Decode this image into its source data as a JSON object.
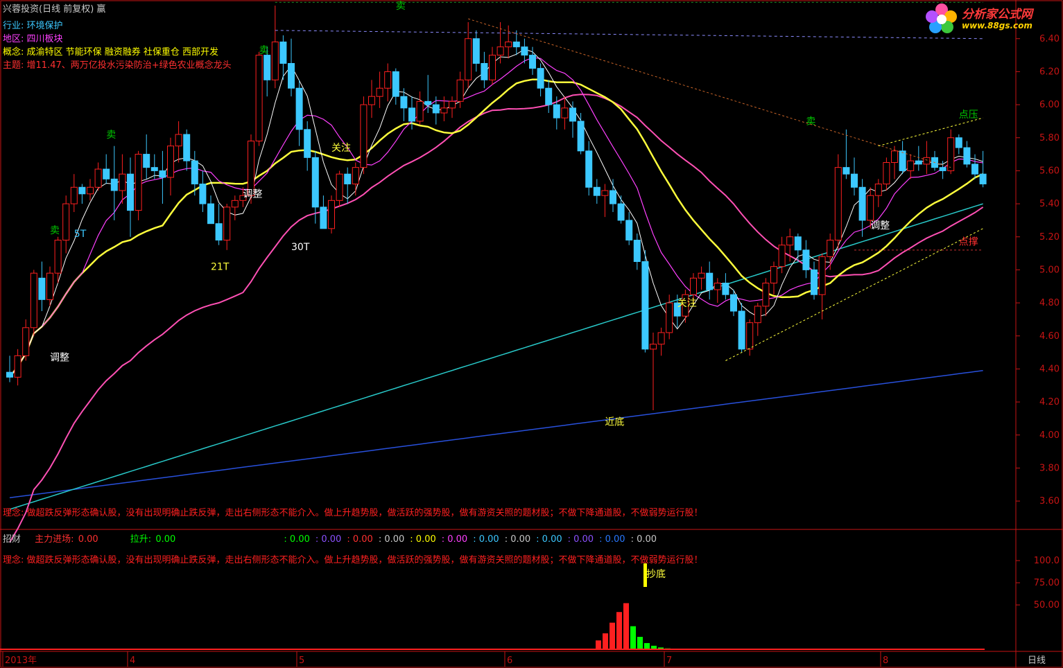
{
  "header": {
    "title": "兴蓉投资(日线 前复权) 赢",
    "industry_label": "行业:",
    "industry": "环境保护",
    "region_label": "地区:",
    "region": "四川板块",
    "concept_label": "概念:",
    "concept": "成渝特区 节能环保 融资融券 社保重仓 西部开发",
    "theme_label": "主题:",
    "theme": "增11.47、两万亿投水污染防治+绿色农业概念龙头"
  },
  "logo": {
    "name": "分析家公式网",
    "url_text": "www.88gs.com"
  },
  "colors": {
    "up": "#ff2020",
    "down": "#3cc8ff",
    "ma5": "#ffffff",
    "ma10": "#ff40ff",
    "ma20": "#ffff3c",
    "ma30_green": "#1e8c28",
    "ma60": "#ff50b4",
    "ma120": "#28c8c8",
    "ma250": "#2850dc",
    "axis": "#c81414"
  },
  "philosophy": "理念: 做超跌反弹形态确认股，没有出现明确止跌反弹，走出右侧形态不能介入。做上升趋势股，做活跃的强势股，做有游资关照的题材股；不做下降通道股，不做弱势运行股！",
  "sub_panel": {
    "name": "招财",
    "main_in_label": "主力进场:",
    "main_in_value": "0.00",
    "lift_label": "拉升:",
    "lift_value": "0.00",
    "values": [
      ": 0.00",
      ": 0.00",
      ": 0.00",
      ": 0.00",
      ": 0.00",
      ": 0.00",
      ": 0.00",
      ": 0.00",
      ": 0.00",
      ": 0.00",
      ": 0.00",
      ": 0.00"
    ],
    "value_colors": [
      "#00ff00",
      "#8c50ff",
      "#ff3030",
      "#c8c8c8",
      "#ffff00",
      "#ff40ff",
      "#3cc8ff",
      "#c8c8c8",
      "#3cc8ff",
      "#8c50ff",
      "#2878ff",
      "#c8c8c8"
    ],
    "marker": "抄底",
    "y_ticks": [
      "100.0",
      "75.00",
      "50.00"
    ],
    "histogram": [
      {
        "x": 863,
        "v": 10,
        "c": "#ff2020"
      },
      {
        "x": 873,
        "v": 18,
        "c": "#ff2020"
      },
      {
        "x": 883,
        "v": 30,
        "c": "#ff2020"
      },
      {
        "x": 893,
        "v": 42,
        "c": "#ff2020"
      },
      {
        "x": 903,
        "v": 52,
        "c": "#ff2020"
      },
      {
        "x": 913,
        "v": 26,
        "c": "#00ff00"
      },
      {
        "x": 923,
        "v": 14,
        "c": "#00ff00"
      },
      {
        "x": 933,
        "v": 7,
        "c": "#00ff00"
      },
      {
        "x": 943,
        "v": 4,
        "c": "#00ff00"
      },
      {
        "x": 953,
        "v": 2,
        "c": "#00ff00"
      },
      {
        "x": 963,
        "v": 1,
        "c": "#00ff00"
      }
    ]
  },
  "x_axis": {
    "labels": [
      "2013年",
      "4",
      "5",
      "6",
      "7",
      "8"
    ],
    "period_label": "日线"
  },
  "chart_data": {
    "type": "candlestick",
    "y_ticks": [
      "6.40",
      "6.20",
      "6.00",
      "5.80",
      "5.60",
      "5.40",
      "5.20",
      "5.00",
      "4.80",
      "4.60",
      "4.40",
      "4.20",
      "4.00",
      "3.80",
      "3.60"
    ],
    "ylim": [
      3.55,
      6.55
    ],
    "candles": [
      [
        4.38,
        4.48,
        4.32,
        4.35
      ],
      [
        4.35,
        4.52,
        4.3,
        4.48
      ],
      [
        4.48,
        4.7,
        4.45,
        4.65
      ],
      [
        4.65,
        5.0,
        4.6,
        4.98
      ],
      [
        4.95,
        5.05,
        4.75,
        4.82
      ],
      [
        4.82,
        5.02,
        4.78,
        4.98
      ],
      [
        4.98,
        5.2,
        4.92,
        5.18
      ],
      [
        5.18,
        5.45,
        5.1,
        5.4
      ],
      [
        5.4,
        5.58,
        5.35,
        5.5
      ],
      [
        5.5,
        5.52,
        5.4,
        5.46
      ],
      [
        5.46,
        5.55,
        5.42,
        5.5
      ],
      [
        5.5,
        5.65,
        5.48,
        5.61
      ],
      [
        5.61,
        5.7,
        5.52,
        5.55
      ],
      [
        5.55,
        5.75,
        5.3,
        5.48
      ],
      [
        5.48,
        5.7,
        5.4,
        5.58
      ],
      [
        5.58,
        5.68,
        5.2,
        5.36
      ],
      [
        5.36,
        5.72,
        5.3,
        5.7
      ],
      [
        5.7,
        5.82,
        5.55,
        5.62
      ],
      [
        5.62,
        5.7,
        5.55,
        5.6
      ],
      [
        5.6,
        5.72,
        5.4,
        5.56
      ],
      [
        5.56,
        5.8,
        5.45,
        5.75
      ],
      [
        5.75,
        5.9,
        5.65,
        5.82
      ],
      [
        5.82,
        5.85,
        5.6,
        5.66
      ],
      [
        5.66,
        5.72,
        5.45,
        5.52
      ],
      [
        5.52,
        5.6,
        5.35,
        5.4
      ],
      [
        5.4,
        5.45,
        5.28,
        5.28
      ],
      [
        5.28,
        5.4,
        5.15,
        5.18
      ],
      [
        5.18,
        5.4,
        5.12,
        5.38
      ],
      [
        5.38,
        5.45,
        5.3,
        5.42
      ],
      [
        5.42,
        5.5,
        5.38,
        5.45
      ],
      [
        5.45,
        5.82,
        5.4,
        5.78
      ],
      [
        5.78,
        6.32,
        5.75,
        6.3
      ],
      [
        6.3,
        6.35,
        6.05,
        6.15
      ],
      [
        6.15,
        6.6,
        6.1,
        6.38
      ],
      [
        6.38,
        6.42,
        6.15,
        6.25
      ],
      [
        6.25,
        6.4,
        6.05,
        6.1
      ],
      [
        6.1,
        6.15,
        5.75,
        5.85
      ],
      [
        5.85,
        5.9,
        5.6,
        5.68
      ],
      [
        5.68,
        5.72,
        5.28,
        5.38
      ],
      [
        5.38,
        5.45,
        5.25,
        5.25
      ],
      [
        5.25,
        5.45,
        5.22,
        5.42
      ],
      [
        5.42,
        5.6,
        5.38,
        5.58
      ],
      [
        5.58,
        5.62,
        5.4,
        5.52
      ],
      [
        5.52,
        5.65,
        5.45,
        5.62
      ],
      [
        5.62,
        6.05,
        5.58,
        6.0
      ],
      [
        6.0,
        6.15,
        5.92,
        6.05
      ],
      [
        6.05,
        6.2,
        5.98,
        6.1
      ],
      [
        6.1,
        6.25,
        6.02,
        6.2
      ],
      [
        6.2,
        6.22,
        6.0,
        6.05
      ],
      [
        6.05,
        6.1,
        5.9,
        5.98
      ],
      [
        5.98,
        6.05,
        5.85,
        5.9
      ],
      [
        5.9,
        6.08,
        5.88,
        6.02
      ],
      [
        6.02,
        6.18,
        5.95,
        6.0
      ],
      [
        6.0,
        6.05,
        5.88,
        5.95
      ],
      [
        5.95,
        6.05,
        5.9,
        5.98
      ],
      [
        5.98,
        6.05,
        5.92,
        6.02
      ],
      [
        6.02,
        6.2,
        5.98,
        6.15
      ],
      [
        6.15,
        6.5,
        6.1,
        6.4
      ],
      [
        6.4,
        6.45,
        6.2,
        6.25
      ],
      [
        6.25,
        6.32,
        6.1,
        6.15
      ],
      [
        6.15,
        6.35,
        6.12,
        6.3
      ],
      [
        6.3,
        6.5,
        6.25,
        6.35
      ],
      [
        6.35,
        6.48,
        6.28,
        6.38
      ],
      [
        6.38,
        6.45,
        6.3,
        6.35
      ],
      [
        6.35,
        6.4,
        6.25,
        6.3
      ],
      [
        6.3,
        6.35,
        6.18,
        6.22
      ],
      [
        6.22,
        6.25,
        6.05,
        6.1
      ],
      [
        6.1,
        6.15,
        5.95,
        6.0
      ],
      [
        6.0,
        6.05,
        5.85,
        5.92
      ],
      [
        5.92,
        6.05,
        5.85,
        5.98
      ],
      [
        5.98,
        6.02,
        5.8,
        5.9
      ],
      [
        5.9,
        5.95,
        5.7,
        5.72
      ],
      [
        5.72,
        5.78,
        5.45,
        5.5
      ],
      [
        5.5,
        5.55,
        5.4,
        5.45
      ],
      [
        5.45,
        5.52,
        5.32,
        5.48
      ],
      [
        5.48,
        5.55,
        5.35,
        5.4
      ],
      [
        5.4,
        5.45,
        5.28,
        5.3
      ],
      [
        5.3,
        5.35,
        5.15,
        5.18
      ],
      [
        5.18,
        5.22,
        5.0,
        5.05
      ],
      [
        5.05,
        5.12,
        4.5,
        4.52
      ],
      [
        4.52,
        4.62,
        4.15,
        4.55
      ],
      [
        4.55,
        4.65,
        4.48,
        4.62
      ],
      [
        4.62,
        4.85,
        4.58,
        4.8
      ],
      [
        4.8,
        4.85,
        4.65,
        4.72
      ],
      [
        4.72,
        4.88,
        4.68,
        4.85
      ],
      [
        4.85,
        4.98,
        4.8,
        4.95
      ],
      [
        4.95,
        5.02,
        4.88,
        4.98
      ],
      [
        4.98,
        5.05,
        4.82,
        4.88
      ],
      [
        4.88,
        4.95,
        4.8,
        4.92
      ],
      [
        4.92,
        4.98,
        4.82,
        4.85
      ],
      [
        4.85,
        4.88,
        4.72,
        4.75
      ],
      [
        4.75,
        4.8,
        4.5,
        4.52
      ],
      [
        4.52,
        4.7,
        4.48,
        4.68
      ],
      [
        4.68,
        4.8,
        4.6,
        4.78
      ],
      [
        4.78,
        4.95,
        4.72,
        4.92
      ],
      [
        4.92,
        5.05,
        4.85,
        5.02
      ],
      [
        5.02,
        5.2,
        4.98,
        5.15
      ],
      [
        5.15,
        5.25,
        5.05,
        5.2
      ],
      [
        5.2,
        5.22,
        5.05,
        5.12
      ],
      [
        5.12,
        5.18,
        4.95,
        5.0
      ],
      [
        5.0,
        5.05,
        4.82,
        4.85
      ],
      [
        4.85,
        5.1,
        4.7,
        5.08
      ],
      [
        5.08,
        5.22,
        5.0,
        5.18
      ],
      [
        5.18,
        5.7,
        5.12,
        5.62
      ],
      [
        5.62,
        5.85,
        5.55,
        5.58
      ],
      [
        5.58,
        5.68,
        5.45,
        5.5
      ],
      [
        5.5,
        5.55,
        5.2,
        5.3
      ],
      [
        5.3,
        5.5,
        5.25,
        5.45
      ],
      [
        5.45,
        5.55,
        5.38,
        5.52
      ],
      [
        5.52,
        5.68,
        5.48,
        5.65
      ],
      [
        5.65,
        5.75,
        5.55,
        5.72
      ],
      [
        5.72,
        5.78,
        5.58,
        5.6
      ],
      [
        5.6,
        5.7,
        5.55,
        5.66
      ],
      [
        5.66,
        5.75,
        5.6,
        5.64
      ],
      [
        5.64,
        5.78,
        5.58,
        5.68
      ],
      [
        5.68,
        5.72,
        5.6,
        5.62
      ],
      [
        5.62,
        5.66,
        5.55,
        5.6
      ],
      [
        5.6,
        5.85,
        5.58,
        5.8
      ],
      [
        5.8,
        5.82,
        5.7,
        5.74
      ],
      [
        5.74,
        5.78,
        5.62,
        5.64
      ],
      [
        5.64,
        5.7,
        5.55,
        5.58
      ],
      [
        5.58,
        5.72,
        5.5,
        5.52
      ]
    ],
    "annotations": [
      {
        "text": "调整",
        "i": 5,
        "price": 4.45,
        "color": "#ffffff"
      },
      {
        "text": "5T",
        "i": 8,
        "price": 5.2,
        "color": "#3cc8ff"
      },
      {
        "text": "卖",
        "i": 5,
        "price": 5.22,
        "color": "#00c800"
      },
      {
        "text": "卖",
        "i": 12,
        "price": 5.8,
        "color": "#00c800"
      },
      {
        "text": "21T",
        "i": 25,
        "price": 5.0,
        "color": "#ffff3c"
      },
      {
        "text": "调整",
        "i": 29,
        "price": 5.44,
        "color": "#ffffff"
      },
      {
        "text": "卖",
        "i": 31,
        "price": 6.31,
        "color": "#00c800"
      },
      {
        "text": "30T",
        "i": 35,
        "price": 5.12,
        "color": "#ffffff"
      },
      {
        "text": "关注",
        "i": 40,
        "price": 5.72,
        "color": "#ffff3c"
      },
      {
        "text": "卖",
        "i": 48,
        "price": 6.58,
        "color": "#00c800"
      },
      {
        "text": "近底",
        "i": 74,
        "price": 4.06,
        "color": "#ffff3c"
      },
      {
        "text": "关注",
        "i": 83,
        "price": 4.78,
        "color": "#ffff3c"
      },
      {
        "text": "卖",
        "i": 99,
        "price": 5.88,
        "color": "#00c800"
      },
      {
        "text": "调整",
        "i": 107,
        "price": 5.25,
        "color": "#ffffff"
      },
      {
        "text": "点压",
        "i": 118,
        "price": 5.92,
        "color": "#00c800"
      },
      {
        "text": "点撑",
        "i": 118,
        "price": 5.15,
        "color": "#ff3030"
      }
    ]
  }
}
